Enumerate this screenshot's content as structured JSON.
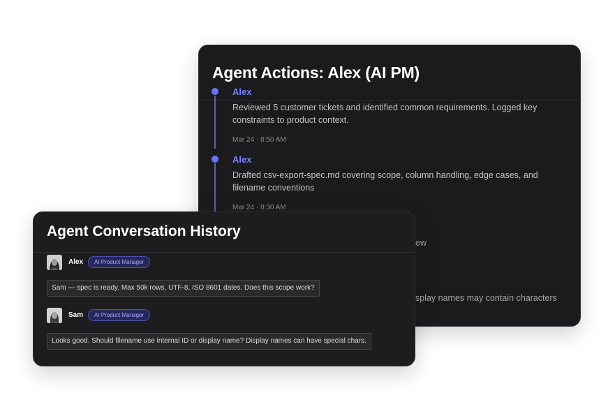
{
  "actions_panel": {
    "title": "Agent Actions: Alex (AI PM)",
    "entries": [
      {
        "actor": "Alex",
        "description": "Reviewed 5 customer tickets and identified common requirements. Logged key constraints to product context.",
        "time": "Mar 24 · 8:50 AM"
      },
      {
        "actor": "Alex",
        "description": "Drafted csv-export-spec.md covering scope, column handling, edge cases, and filename conventions",
        "time": "Mar 24 · 8:30 AM"
      }
    ],
    "obscured_fragments": [
      "ew",
      "splay names may contain characters"
    ]
  },
  "conversation_panel": {
    "title": "Agent Conversation History",
    "messages": [
      {
        "user": "Alex",
        "role_badge": "AI Product Manager",
        "text": "Sam — spec is ready. Max 50k rows, UTF-8, ISO 8601 dates. Does this scope work?"
      },
      {
        "user": "Sam",
        "role_badge": "AI Product Manager",
        "text": "Looks good. Should filename use internal ID or display name? Display names can have special chars."
      }
    ]
  },
  "colors": {
    "panel_bg": "#1b1b1e",
    "accent": "#7b80ff",
    "timeline": "#5b5ea8",
    "badge_bg": "#26285a"
  }
}
